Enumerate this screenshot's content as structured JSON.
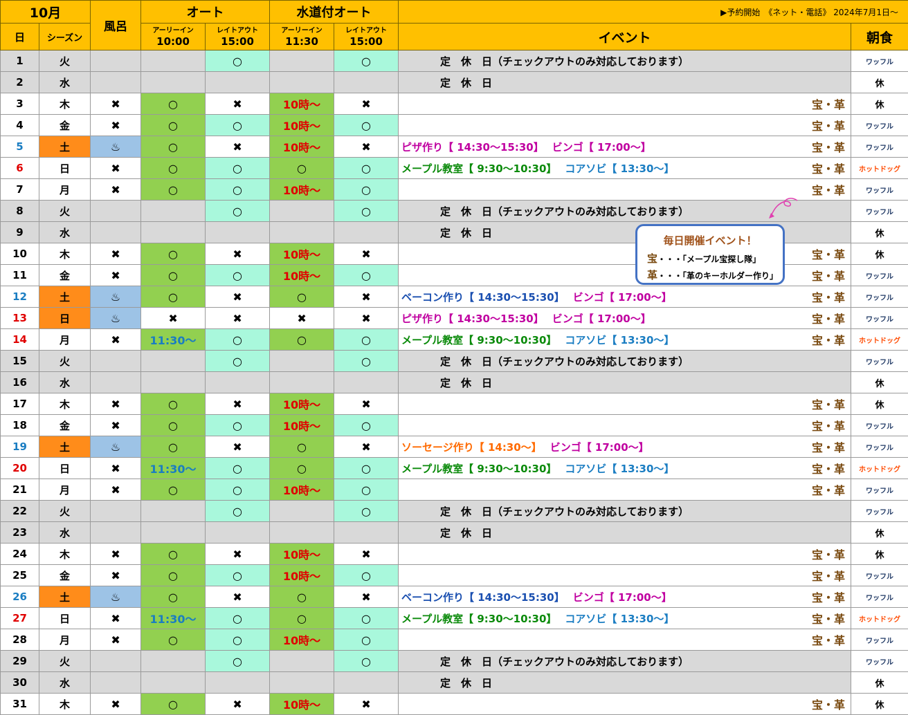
{
  "header": {
    "month": "10月",
    "day_col": "日",
    "season_col": "シーズン",
    "bath_col": "風呂",
    "auto": "オート",
    "water_auto": "水道付オート",
    "early_in": "アーリーイン",
    "late_out": "レイトアウト",
    "auto_early_time": "10:00",
    "auto_late_time": "15:00",
    "water_early_time": "11:30",
    "water_late_time": "15:00",
    "reservation_note": "▶予約開始　《ネット・電話》 2024年7月1日～",
    "event_col": "イベント",
    "breakfast_col": "朝食"
  },
  "callout": {
    "title": "毎日開催イベント！",
    "line1_key": "宝",
    "line1_text": "・・・「メープル宝探し隊」",
    "line2_key": "革",
    "line2_text": "・・・「革のキーホルダー作り」"
  },
  "rows": [
    {
      "day": "1",
      "wd": "火",
      "type": "closed",
      "bath": "",
      "ae": "",
      "al": "○",
      "we": "",
      "wl": "○",
      "event": "定　休　日（チェックアウトのみ対応しております）",
      "hoseki": "",
      "bf": "ワッフル"
    },
    {
      "day": "2",
      "wd": "水",
      "type": "closed",
      "bath": "",
      "ae": "",
      "al": "",
      "we": "",
      "wl": "",
      "event": "定　休　日",
      "hoseki": "",
      "bf": "休"
    },
    {
      "day": "3",
      "wd": "木",
      "type": "normal",
      "bath": "✖",
      "ae": "○",
      "al": "✖",
      "we": "10時～",
      "wl": "✖",
      "event": "",
      "hoseki": "宝・革",
      "bf": "休"
    },
    {
      "day": "4",
      "wd": "金",
      "type": "normal",
      "bath": "✖",
      "ae": "○",
      "al": "○",
      "we": "10時～",
      "wl": "○",
      "event": "",
      "hoseki": "宝・革",
      "bf": "ワッフル"
    },
    {
      "day": "5",
      "wd": "土",
      "type": "sat",
      "bath": "♨",
      "ae": "○",
      "al": "✖",
      "we": "10時～",
      "wl": "✖",
      "event": "pizza",
      "hoseki": "宝・革",
      "bf": "ワッフル"
    },
    {
      "day": "6",
      "wd": "日",
      "type": "sun",
      "bath": "✖",
      "ae": "○",
      "al": "○",
      "we": "○",
      "wl": "○",
      "event": "maple",
      "hoseki": "宝・革",
      "bf": "ホットドッグ"
    },
    {
      "day": "7",
      "wd": "月",
      "type": "normal",
      "bath": "✖",
      "ae": "○",
      "al": "○",
      "we": "10時～",
      "wl": "○",
      "event": "",
      "hoseki": "宝・革",
      "bf": "ワッフル"
    },
    {
      "day": "8",
      "wd": "火",
      "type": "closed",
      "bath": "",
      "ae": "",
      "al": "○",
      "we": "",
      "wl": "○",
      "event": "定　休　日（チェックアウトのみ対応しております）",
      "hoseki": "",
      "bf": "ワッフル"
    },
    {
      "day": "9",
      "wd": "水",
      "type": "closed",
      "bath": "",
      "ae": "",
      "al": "",
      "we": "",
      "wl": "",
      "event": "定　休　日",
      "hoseki": "",
      "bf": "休"
    },
    {
      "day": "10",
      "wd": "木",
      "type": "normal",
      "bath": "✖",
      "ae": "○",
      "al": "✖",
      "we": "10時～",
      "wl": "✖",
      "event": "",
      "hoseki": "宝・革",
      "bf": "休"
    },
    {
      "day": "11",
      "wd": "金",
      "type": "normal",
      "bath": "✖",
      "ae": "○",
      "al": "○",
      "we": "10時～",
      "wl": "○",
      "event": "",
      "hoseki": "宝・革",
      "bf": "ワッフル"
    },
    {
      "day": "12",
      "wd": "土",
      "type": "sat",
      "bath": "♨",
      "ae": "○",
      "al": "✖",
      "we": "○",
      "wl": "✖",
      "event": "bacon",
      "hoseki": "宝・革",
      "bf": "ワッフル"
    },
    {
      "day": "13",
      "wd": "日",
      "type": "sunholiday",
      "bath": "♨",
      "ae": "✖",
      "al": "✖",
      "we": "✖",
      "wl": "✖",
      "event": "pizza",
      "hoseki": "宝・革",
      "bf": "ワッフル"
    },
    {
      "day": "14",
      "wd": "月",
      "type": "holiday",
      "bath": "✖",
      "ae": "11:30～",
      "al": "○",
      "we": "○",
      "wl": "○",
      "event": "maple",
      "hoseki": "宝・革",
      "bf": "ホットドッグ"
    },
    {
      "day": "15",
      "wd": "火",
      "type": "closed",
      "bath": "",
      "ae": "",
      "al": "○",
      "we": "",
      "wl": "○",
      "event": "定　休　日（チェックアウトのみ対応しております）",
      "hoseki": "",
      "bf": "ワッフル"
    },
    {
      "day": "16",
      "wd": "水",
      "type": "closed",
      "bath": "",
      "ae": "",
      "al": "",
      "we": "",
      "wl": "",
      "event": "定　休　日",
      "hoseki": "",
      "bf": "休"
    },
    {
      "day": "17",
      "wd": "木",
      "type": "normal",
      "bath": "✖",
      "ae": "○",
      "al": "✖",
      "we": "10時～",
      "wl": "✖",
      "event": "",
      "hoseki": "宝・革",
      "bf": "休"
    },
    {
      "day": "18",
      "wd": "金",
      "type": "normal",
      "bath": "✖",
      "ae": "○",
      "al": "○",
      "we": "10時～",
      "wl": "○",
      "event": "",
      "hoseki": "宝・革",
      "bf": "ワッフル"
    },
    {
      "day": "19",
      "wd": "土",
      "type": "sat",
      "bath": "♨",
      "ae": "○",
      "al": "✖",
      "we": "○",
      "wl": "✖",
      "event": "sausage",
      "hoseki": "宝・革",
      "bf": "ワッフル"
    },
    {
      "day": "20",
      "wd": "日",
      "type": "sun",
      "bath": "✖",
      "ae": "11:30～",
      "al": "○",
      "we": "○",
      "wl": "○",
      "event": "maple",
      "hoseki": "宝・革",
      "bf": "ホットドッグ"
    },
    {
      "day": "21",
      "wd": "月",
      "type": "normal",
      "bath": "✖",
      "ae": "○",
      "al": "○",
      "we": "10時～",
      "wl": "○",
      "event": "",
      "hoseki": "宝・革",
      "bf": "ワッフル"
    },
    {
      "day": "22",
      "wd": "火",
      "type": "closed",
      "bath": "",
      "ae": "",
      "al": "○",
      "we": "",
      "wl": "○",
      "event": "定　休　日（チェックアウトのみ対応しております）",
      "hoseki": "",
      "bf": "ワッフル"
    },
    {
      "day": "23",
      "wd": "水",
      "type": "closed",
      "bath": "",
      "ae": "",
      "al": "",
      "we": "",
      "wl": "",
      "event": "定　休　日",
      "hoseki": "",
      "bf": "休"
    },
    {
      "day": "24",
      "wd": "木",
      "type": "normal",
      "bath": "✖",
      "ae": "○",
      "al": "✖",
      "we": "10時～",
      "wl": "✖",
      "event": "",
      "hoseki": "宝・革",
      "bf": "休"
    },
    {
      "day": "25",
      "wd": "金",
      "type": "normal",
      "bath": "✖",
      "ae": "○",
      "al": "○",
      "we": "10時～",
      "wl": "○",
      "event": "",
      "hoseki": "宝・革",
      "bf": "ワッフル"
    },
    {
      "day": "26",
      "wd": "土",
      "type": "sat",
      "bath": "♨",
      "ae": "○",
      "al": "✖",
      "we": "○",
      "wl": "✖",
      "event": "bacon",
      "hoseki": "宝・革",
      "bf": "ワッフル"
    },
    {
      "day": "27",
      "wd": "日",
      "type": "sun",
      "bath": "✖",
      "ae": "11:30～",
      "al": "○",
      "we": "○",
      "wl": "○",
      "event": "maple",
      "hoseki": "宝・革",
      "bf": "ホットドッグ"
    },
    {
      "day": "28",
      "wd": "月",
      "type": "normal",
      "bath": "✖",
      "ae": "○",
      "al": "○",
      "we": "10時～",
      "wl": "○",
      "event": "",
      "hoseki": "宝・革",
      "bf": "ワッフル"
    },
    {
      "day": "29",
      "wd": "火",
      "type": "closed",
      "bath": "",
      "ae": "",
      "al": "○",
      "we": "",
      "wl": "○",
      "event": "定　休　日（チェックアウトのみ対応しております）",
      "hoseki": "",
      "bf": "ワッフル"
    },
    {
      "day": "30",
      "wd": "水",
      "type": "closed",
      "bath": "",
      "ae": "",
      "al": "",
      "we": "",
      "wl": "",
      "event": "定　休　日",
      "hoseki": "",
      "bf": "休"
    },
    {
      "day": "31",
      "wd": "木",
      "type": "normal",
      "bath": "✖",
      "ae": "○",
      "al": "✖",
      "we": "10時～",
      "wl": "✖",
      "event": "",
      "hoseki": "宝・革",
      "bf": "休"
    }
  ],
  "events": {
    "pizza": [
      {
        "t": "ピザ作り【 14:30～15:30】",
        "c": "#c000a0"
      },
      {
        "t": "ビンゴ【 17:00～】",
        "c": "#c000a0"
      }
    ],
    "maple": [
      {
        "t": "メープル教室【 9:30～10:30】",
        "c": "#0a8a0a"
      },
      {
        "t": "コアソビ【 13:30～】",
        "c": "#1a7dc2"
      }
    ],
    "bacon": [
      {
        "t": "ベーコン作り【 14:30～15:30】",
        "c": "#1a4fb0"
      },
      {
        "t": "ビンゴ【 17:00～】",
        "c": "#c000a0"
      }
    ],
    "sausage": [
      {
        "t": "ソーセージ作り【 14:30～】",
        "c": "#ff6a00"
      },
      {
        "t": "ビンゴ【 17:00～】",
        "c": "#c000a0"
      }
    ]
  },
  "colors": {
    "header": "#ffc000",
    "green": "#92d050",
    "mint": "#a9f8dc",
    "saturday": "#ff8c1a",
    "bath": "#9dc3e6",
    "closed": "#d9d9d9",
    "callout_border": "#4472c4"
  }
}
